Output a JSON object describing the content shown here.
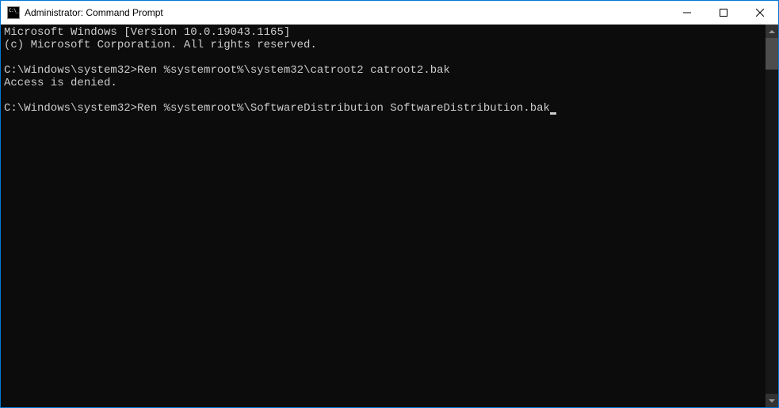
{
  "window": {
    "title": "Administrator: Command Prompt"
  },
  "terminal": {
    "header1": "Microsoft Windows [Version 10.0.19043.1165]",
    "header2": "(c) Microsoft Corporation. All rights reserved.",
    "blank": "",
    "prompt1": "C:\\Windows\\system32>",
    "cmd1": "Ren %systemroot%\\system32\\catroot2 catroot2.bak",
    "out1": "Access is denied.",
    "prompt2": "C:\\Windows\\system32>",
    "cmd2": "Ren %systemroot%\\SoftwareDistribution SoftwareDistribution.bak"
  }
}
